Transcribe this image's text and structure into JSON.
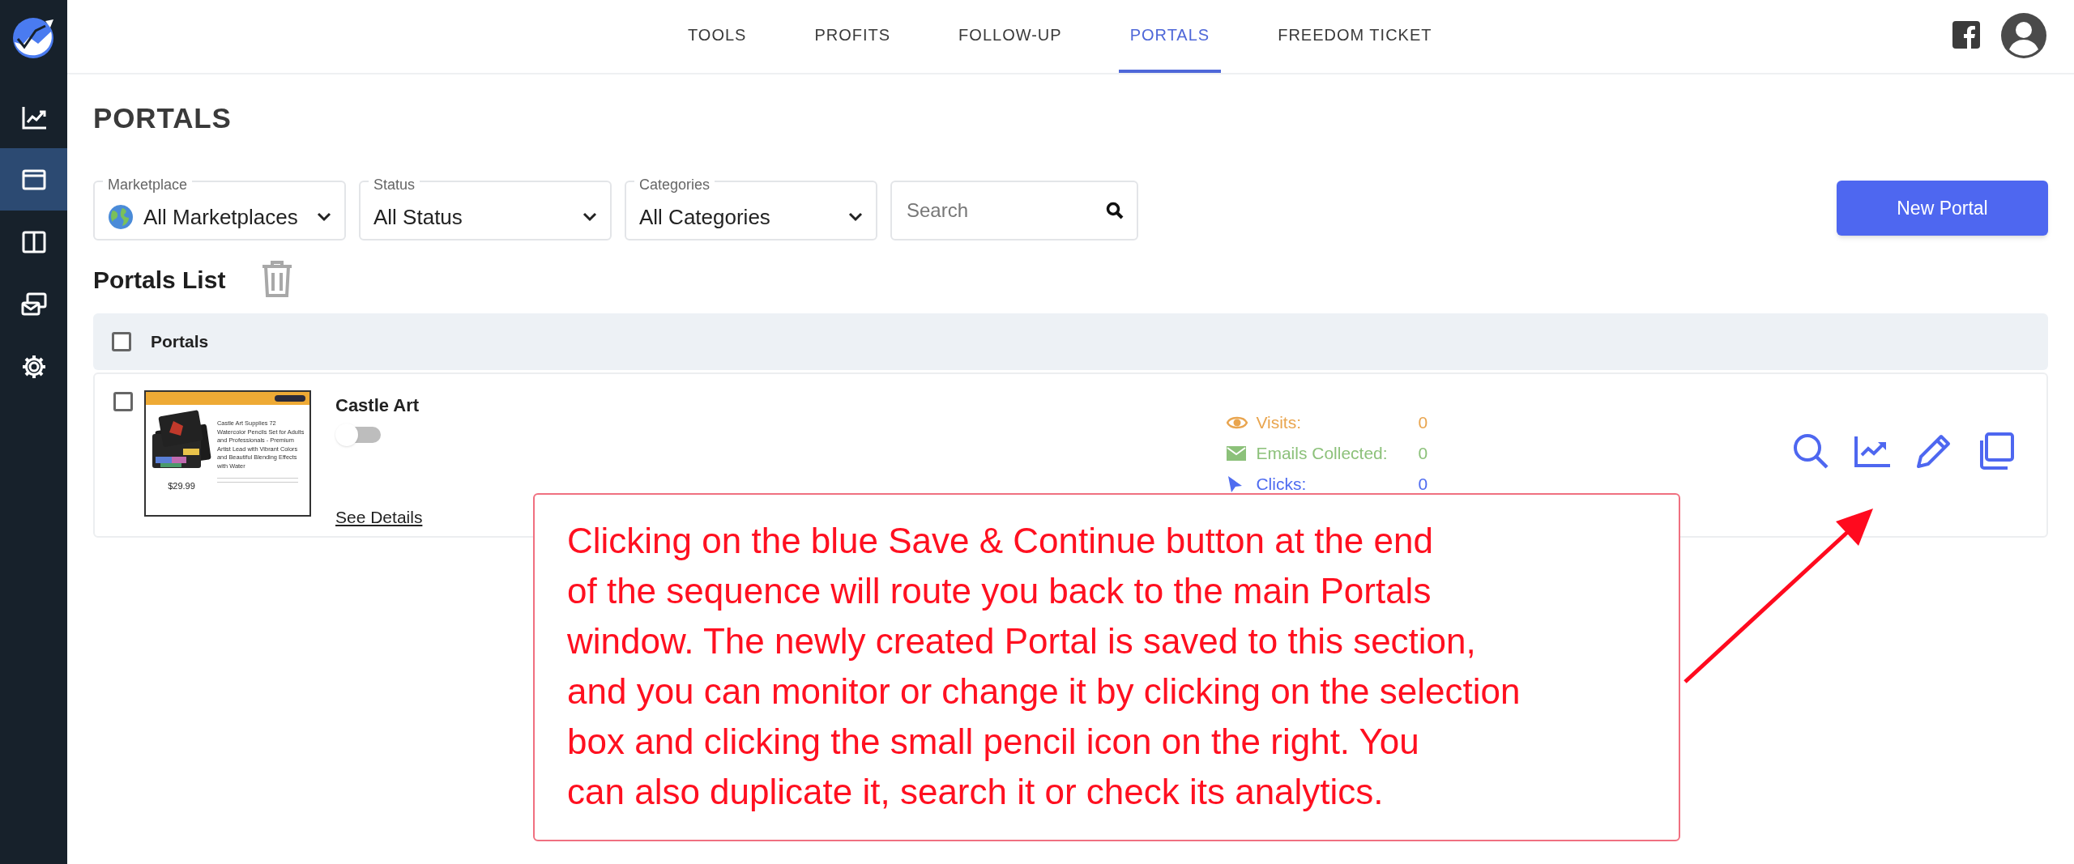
{
  "sidebar": {
    "items": [
      {
        "kind": "chart",
        "selected": false
      },
      {
        "kind": "window",
        "selected": true
      },
      {
        "kind": "columns",
        "selected": false
      },
      {
        "kind": "mail",
        "selected": false
      },
      {
        "kind": "gear",
        "selected": false
      }
    ]
  },
  "nav": {
    "tabs": [
      {
        "label": "TOOLS",
        "selected": false
      },
      {
        "label": "PROFITS",
        "selected": false
      },
      {
        "label": "FOLLOW-UP",
        "selected": false
      },
      {
        "label": "PORTALS",
        "selected": true
      },
      {
        "label": "FREEDOM TICKET",
        "selected": false
      }
    ]
  },
  "page_title": "PORTALS",
  "filters": [
    {
      "kind": "marketplace",
      "label": "Marketplace",
      "value": "All Marketplaces"
    },
    {
      "kind": "select",
      "label": "Status",
      "value": "All Status"
    },
    {
      "kind": "select",
      "label": "Categories",
      "value": "All Categories"
    },
    {
      "kind": "search",
      "placeholder": "Search"
    }
  ],
  "new_button": "New Portal",
  "list_title": "Portals List",
  "table": {
    "header": {
      "label": "Portals",
      "checked": false
    },
    "rows": [
      {
        "checked": false,
        "name": "Castle Art",
        "on": false,
        "link": "See Details",
        "thumbnail": {
          "title": "Castle Art Supplies 72 Watercolor Pencils Set for Adults and Professionals - Premium Artist Lead with Vibrant Colors and Beautiful Blending Effects with Water",
          "price": "$29.99"
        },
        "stats": [
          {
            "kind": "visits",
            "label": "Visits:",
            "value": "0",
            "color": "#e9a54f"
          },
          {
            "kind": "emails",
            "label": "Emails Collected:",
            "value": "0",
            "color": "#8cc17a"
          },
          {
            "kind": "clicks",
            "label": "Clicks:",
            "value": "0",
            "color": "#4f6cf0"
          }
        ]
      }
    ]
  },
  "callout": {
    "lines": [
      "Clicking on the blue Save & Continue button at the end",
      "of the sequence will route you back to the main Portals",
      "window. The newly created Portal is saved to this section,",
      "and you can monitor or change it by clicking on the selection",
      "box and clicking the small pencil icon on the right. You",
      "can also duplicate it, search it or check its analytics."
    ]
  }
}
